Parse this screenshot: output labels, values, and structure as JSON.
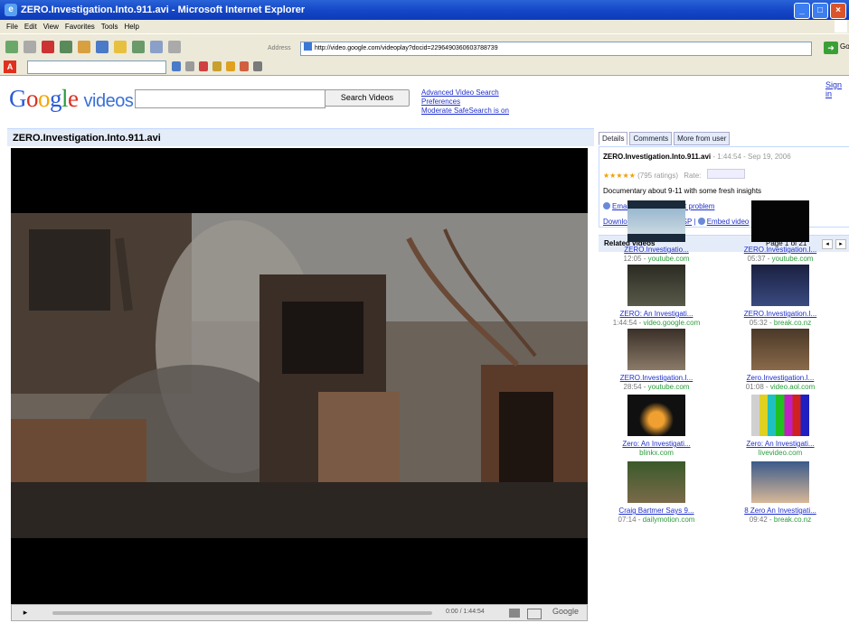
{
  "window": {
    "title": "ZERO.Investigation.Into.911.avi - Microsoft Internet Explorer",
    "buttons": {
      "minimize": "_",
      "maximize": "□",
      "close": "×"
    }
  },
  "menu": [
    "File",
    "Edit",
    "View",
    "Favorites",
    "Tools",
    "Help"
  ],
  "address": {
    "label": "Address",
    "url": "http://video.google.com/videoplay?docid=2296490360603788739",
    "go": "Go"
  },
  "toolbar2": {
    "brand_letter": "A"
  },
  "google": {
    "logo_letters": [
      "G",
      "o",
      "o",
      "g",
      "l",
      "e"
    ],
    "logo_suffix": "videos",
    "search_placeholder": "",
    "search_button": "Search Videos",
    "links": [
      "Advanced Video Search",
      "Preferences",
      "Moderate SafeSearch is on"
    ],
    "sign_in": "Sign in"
  },
  "video": {
    "title": "ZERO.Investigation.Into.911.avi",
    "controls": {
      "play": "▸",
      "time": "0:00 / 1:44:54",
      "logo": "Google"
    }
  },
  "details": {
    "tabs": [
      "Details",
      "Comments",
      "More from user"
    ],
    "title": "ZERO.Investigation.Into.911.avi",
    "meta": " - 1:44:54 - Sep 19, 2006",
    "stars": "★★★★★",
    "ratings": "(795 ratings)",
    "rate_label": "Rate:",
    "description": "Documentary about 9-11 with some fresh insights",
    "email": "Email this video",
    "report": "Report problem",
    "download": "Download video - iPod/PSP",
    "separator": "|",
    "embed": "Embed video"
  },
  "related": {
    "heading": "Related videos",
    "page": "Page 1 of 21",
    "prev": "◂",
    "next": "▸",
    "items": [
      {
        "title": "ZERO.Investigatio...",
        "dur": "12:05",
        "source": "youtube.com"
      },
      {
        "title": "ZERO.Investigation.I...",
        "dur": "05:37",
        "source": "youtube.com"
      },
      {
        "title": "ZERO: An Investigati...",
        "dur": "1:44:54",
        "source": "video.google.com"
      },
      {
        "title": "ZERO.Investigation.I...",
        "dur": "05:32",
        "source": "break.co.nz"
      },
      {
        "title": "ZERO.Investigation.I...",
        "dur": "28:54",
        "source": "youtube.com"
      },
      {
        "title": "Zero.Investigation.I...",
        "dur": "01:08",
        "source": "video.aol.com"
      },
      {
        "title": "Zero: An Investigati...",
        "dur": "",
        "source": "blinkx.com"
      },
      {
        "title": "Zero: An Investigati...",
        "dur": "",
        "source": "livevideo.com"
      },
      {
        "title": "Craig Bartmer Says 9...",
        "dur": "07:14",
        "source": "dailymotion.com"
      },
      {
        "title": "8 Zero An Investigati...",
        "dur": "09:42",
        "source": "break.co.nz"
      }
    ]
  }
}
